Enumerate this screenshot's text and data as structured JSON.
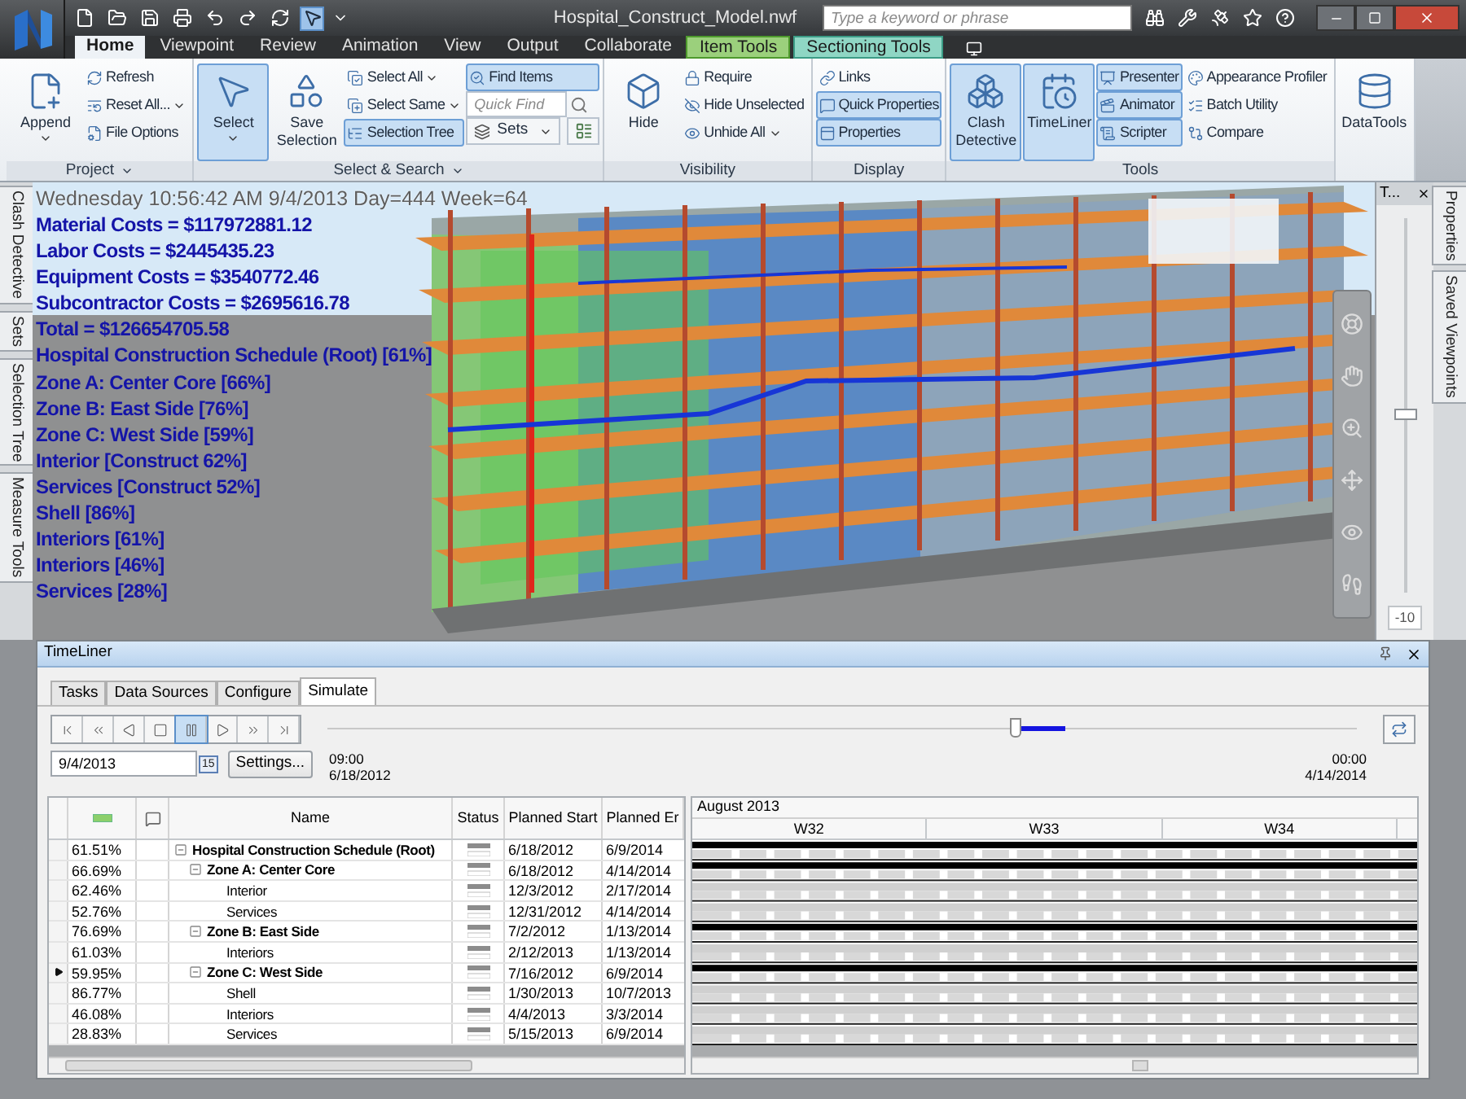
{
  "window": {
    "title": "Hospital_Construct_Model.nwf",
    "search_placeholder": "Type a keyword or phrase"
  },
  "ribbon_tabs": [
    {
      "label": "Home",
      "selected": true,
      "kind": "tab"
    },
    {
      "label": "Viewpoint",
      "selected": false,
      "kind": "tab"
    },
    {
      "label": "Review",
      "selected": false,
      "kind": "tab"
    },
    {
      "label": "Animation",
      "selected": false,
      "kind": "tab"
    },
    {
      "label": "View",
      "selected": false,
      "kind": "tab"
    },
    {
      "label": "Output",
      "selected": false,
      "kind": "tab"
    },
    {
      "label": "Collaborate",
      "selected": false,
      "kind": "tab"
    },
    {
      "label": "Item Tools",
      "selected": false,
      "kind": "contextual-green"
    },
    {
      "label": "Sectioning Tools",
      "selected": false,
      "kind": "contextual-teal"
    }
  ],
  "ribbon_groups": [
    {
      "label": "Project",
      "menu": true,
      "columns": [
        [
          {
            "label": "Append",
            "kind": "large",
            "active": false,
            "dropdown": true
          }
        ],
        [
          {
            "label": "Refresh",
            "kind": "small",
            "active": false,
            "dropdown": false
          },
          {
            "label": "Reset All...",
            "kind": "small",
            "active": false,
            "dropdown": true
          },
          {
            "label": "File Options",
            "kind": "small",
            "active": false,
            "dropdown": false
          }
        ]
      ]
    },
    {
      "label": "Select & Search",
      "menu": true,
      "columns": [
        [
          {
            "label": "Select",
            "kind": "large",
            "active": true,
            "dropdown": true
          }
        ],
        [
          {
            "label": "Save Selection",
            "kind": "large",
            "active": false,
            "dropdown": false
          }
        ],
        [
          {
            "label": "Select All",
            "kind": "small",
            "active": false,
            "dropdown": true
          },
          {
            "label": "Select Same",
            "kind": "small",
            "active": false,
            "dropdown": true
          },
          {
            "label": "Selection Tree",
            "kind": "small",
            "active": true,
            "dropdown": false
          }
        ],
        [
          {
            "label": "Find Items",
            "kind": "small",
            "active": true,
            "dropdown": false
          },
          {
            "placeholder": "Quick Find",
            "kind": "field"
          },
          {
            "label": "Sets",
            "kind": "combo"
          }
        ]
      ]
    },
    {
      "label": "Visibility",
      "menu": false,
      "columns": [
        [
          {
            "label": "Hide",
            "kind": "large",
            "active": false,
            "dropdown": false
          }
        ],
        [
          {
            "label": "Require",
            "kind": "small",
            "active": false,
            "dropdown": false
          },
          {
            "label": "Hide Unselected",
            "kind": "small",
            "active": false,
            "dropdown": false
          },
          {
            "label": "Unhide All",
            "kind": "small",
            "active": false,
            "dropdown": true
          }
        ]
      ]
    },
    {
      "label": "Display",
      "menu": false,
      "columns": [
        [
          {
            "label": "Links",
            "kind": "small",
            "active": false,
            "dropdown": false
          },
          {
            "label": "Quick Properties",
            "kind": "small",
            "active": true,
            "dropdown": false
          },
          {
            "label": "Properties",
            "kind": "small",
            "active": true,
            "dropdown": false
          }
        ]
      ]
    },
    {
      "label": "Tools",
      "menu": false,
      "columns": [
        [
          {
            "label": "Clash Detective",
            "kind": "large",
            "active": true,
            "dropdown": false
          }
        ],
        [
          {
            "label": "TimeLiner",
            "kind": "large",
            "active": true,
            "dropdown": false
          }
        ],
        [
          {
            "label": "Presenter",
            "kind": "small",
            "active": true,
            "dropdown": false
          },
          {
            "label": "Animator",
            "kind": "small",
            "active": true,
            "dropdown": false
          },
          {
            "label": "Scripter",
            "kind": "small",
            "active": true,
            "dropdown": false
          }
        ],
        [
          {
            "label": "Appearance Profiler",
            "kind": "small",
            "active": false,
            "dropdown": false
          },
          {
            "label": "Batch Utility",
            "kind": "small",
            "active": false,
            "dropdown": false
          },
          {
            "label": "Compare",
            "kind": "small",
            "active": false,
            "dropdown": false
          }
        ]
      ]
    },
    {
      "columns": [
        [
          {
            "label": "DataTools",
            "kind": "large",
            "active": false,
            "dropdown": false
          }
        ]
      ]
    }
  ],
  "left_tabs": [
    "Clash Detective",
    "Sets",
    "Selection Tree",
    "Measure Tools"
  ],
  "right_tabs": [
    "Properties",
    "Saved Viewpoints"
  ],
  "viewport_overlay": [
    {
      "text": "Wednesday 10:56:42 AM 9/4/2013 Day=444 Week=64",
      "kind": "clock"
    },
    {
      "text": "Material Costs = $117972881.12",
      "kind": "metric"
    },
    {
      "text": "Labor Costs = $2445435.23",
      "kind": "metric"
    },
    {
      "text": "Equipment Costs = $3540772.46",
      "kind": "metric"
    },
    {
      "text": "Subcontractor Costs = $2695616.78",
      "kind": "metric"
    },
    {
      "text": "Total = $126654705.58",
      "kind": "metric"
    },
    {
      "text": "Hospital Construction Schedule (Root) [61%]",
      "kind": "metric"
    },
    {
      "text": "Zone A: Center Core [66%]",
      "kind": "metric"
    },
    {
      "text": "Zone B: East Side [76%]",
      "kind": "metric"
    },
    {
      "text": "Zone C: West Side [59%]",
      "kind": "metric"
    },
    {
      "text": "Interior [Construct 62%]",
      "kind": "metric"
    },
    {
      "text": "Services [Construct 52%]",
      "kind": "metric"
    },
    {
      "text": "Shell [86%]",
      "kind": "metric"
    },
    {
      "text": "Interiors [61%]",
      "kind": "metric"
    },
    {
      "text": "Interiors [46%]",
      "kind": "metric"
    },
    {
      "text": "Services [28%]",
      "kind": "metric"
    }
  ],
  "side_panel": {
    "title": "T...",
    "zoom": {
      "level": 0.48,
      "reading": "-10"
    }
  },
  "timeliner": {
    "title": "TimeLiner",
    "tabs": [
      {
        "label": "Tasks",
        "selected": false
      },
      {
        "label": "Data Sources",
        "selected": false
      },
      {
        "label": "Configure",
        "selected": false
      },
      {
        "label": "Simulate",
        "selected": true
      }
    ],
    "playback_buttons": [
      {
        "selected": false
      },
      {
        "selected": false
      },
      {
        "selected": false
      },
      {
        "selected": false
      },
      {
        "selected": true
      },
      {
        "selected": false
      },
      {
        "selected": false
      },
      {
        "selected": false
      }
    ],
    "slider": {
      "level": 0.667
    },
    "date_field": {
      "value": "9/4/2013",
      "calendar_day": "15"
    },
    "settings_button": "Settings...",
    "start": {
      "time": "09:00",
      "date": "6/18/2012"
    },
    "end": {
      "time": "00:00",
      "date": "4/14/2014"
    },
    "table": {
      "columns": [
        "Name",
        "Status",
        "Planned Start",
        "Planned Er"
      ],
      "rows": [
        {
          "active": "61.51%",
          "name": "Hospital Construction Schedule (Root)",
          "start": "6/18/2012",
          "end": "6/9/2014",
          "selected": false,
          "expanded": true,
          "children": [
            {
              "active": "66.69%",
              "name": "Zone A: Center Core",
              "start": "6/18/2012",
              "end": "4/14/2014",
              "selected": false,
              "expanded": true,
              "children": [
                {
                  "active": "62.46%",
                  "name": "Interior",
                  "start": "12/3/2012",
                  "end": "2/17/2014",
                  "selected": false
                },
                {
                  "active": "52.76%",
                  "name": "Services",
                  "start": "12/31/2012",
                  "end": "4/14/2014",
                  "selected": false
                }
              ]
            },
            {
              "active": "76.69%",
              "name": "Zone B: East Side",
              "start": "7/2/2012",
              "end": "1/13/2014",
              "selected": false,
              "expanded": true,
              "children": [
                {
                  "active": "61.03%",
                  "name": "Interiors",
                  "start": "2/12/2013",
                  "end": "1/13/2014",
                  "selected": false
                }
              ]
            },
            {
              "active": "59.95%",
              "name": "Zone C: West Side",
              "start": "7/16/2012",
              "end": "6/9/2014",
              "selected": true,
              "expanded": true,
              "children": [
                {
                  "active": "86.77%",
                  "name": "Shell",
                  "start": "1/30/2013",
                  "end": "10/7/2013",
                  "selected": false
                },
                {
                  "active": "46.08%",
                  "name": "Interiors",
                  "start": "4/4/2013",
                  "end": "3/3/2014",
                  "selected": false
                },
                {
                  "active": "28.83%",
                  "name": "Services",
                  "start": "5/15/2013",
                  "end": "6/9/2014",
                  "selected": false
                }
              ]
            }
          ]
        }
      ]
    },
    "gantt": {
      "month": "August 2013",
      "weeks": [
        "W32",
        "W33",
        "W34"
      ]
    }
  }
}
